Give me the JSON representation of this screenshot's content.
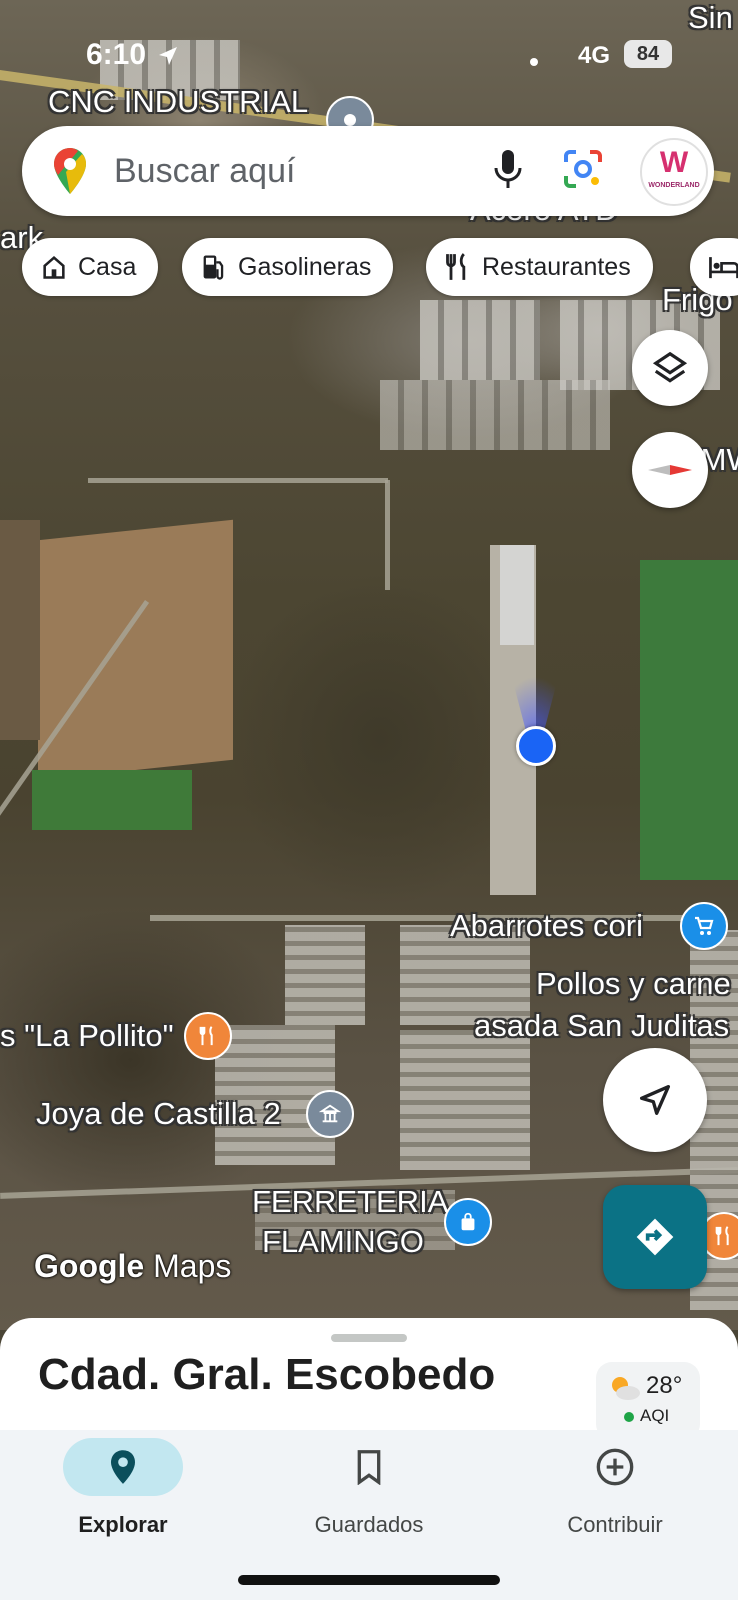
{
  "status_bar": {
    "time": "6:10",
    "network": "4G",
    "battery": "84"
  },
  "search": {
    "placeholder": "Buscar aquí"
  },
  "avatar": {
    "text_logo": "W",
    "brand": "WONDERLAND"
  },
  "chips": [
    {
      "label": "Casa",
      "icon": "home-icon"
    },
    {
      "label": "Gasolineras",
      "icon": "gas-station-icon"
    },
    {
      "label": "Restaurantes",
      "icon": "restaurant-icon"
    },
    {
      "label": "",
      "icon": "hotel-icon"
    }
  ],
  "map_labels": {
    "cnc": "CNC INDUSTRIAL",
    "acero": "Acero ATD",
    "park": "ark",
    "frigo": "Frigo",
    "bmw": "BMW",
    "sin": "Sin",
    "abarrotes": "Abarrotes cori",
    "pollos_1": "Pollos y carne",
    "pollos_2": "asada San Juditas",
    "pollito": "s \"La Pollito\"",
    "joya": "Joya de Castilla 2",
    "ferreteria_1": "FERRETERIA",
    "ferreteria_2": "FLAMINGO"
  },
  "logo": {
    "google": "Google",
    "maps": "Maps"
  },
  "place_sheet": {
    "name": "Cdad. Gral. Escobedo",
    "temperature": "28°",
    "aqi_label": "AQI"
  },
  "colors": {
    "accent": "#0b7285",
    "location_blue": "#1a64f5",
    "nav_active": "#c2e7f0"
  },
  "nav": [
    {
      "label": "Explorar",
      "icon": "explore-pin-icon",
      "active": true
    },
    {
      "label": "Guardados",
      "icon": "bookmark-icon",
      "active": false
    },
    {
      "label": "Contribuir",
      "icon": "add-circle-icon",
      "active": false
    }
  ]
}
